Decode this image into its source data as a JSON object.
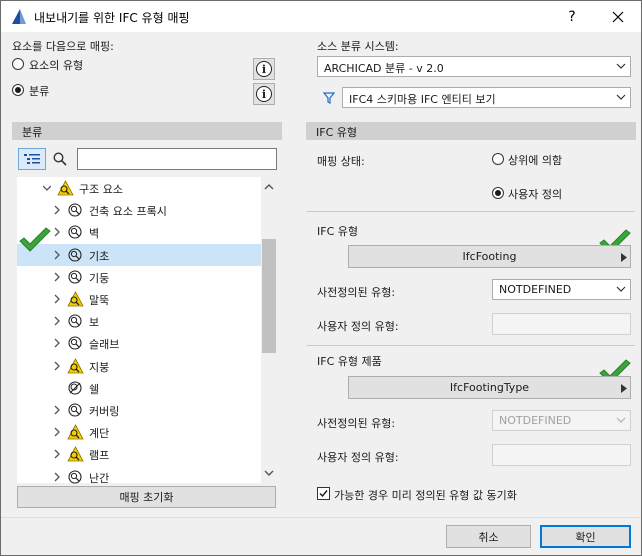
{
  "window": {
    "title": "내보내기를 위한 IFC 유형 매핑",
    "help_label": "?",
    "close_label": "✕"
  },
  "left": {
    "map_elements_label": "요소를 다음으로 매핑:",
    "option_element_type": "요소의 유형",
    "option_classification": "분류",
    "selected_option": "classification",
    "panel_title": "분류",
    "search_value": "",
    "tree": [
      {
        "label": "구조 요소",
        "level": 0,
        "expanded": true,
        "icon": "warning-classification-icon"
      },
      {
        "label": "건축 요소 프록시",
        "level": 1,
        "icon": "classification-icon"
      },
      {
        "label": "벽",
        "level": 1,
        "icon": "classification-icon"
      },
      {
        "label": "기초",
        "level": 1,
        "icon": "classification-icon",
        "selected": true,
        "mapped": true
      },
      {
        "label": "기둥",
        "level": 1,
        "icon": "classification-icon"
      },
      {
        "label": "말뚝",
        "level": 1,
        "icon": "warning-classification-icon"
      },
      {
        "label": "보",
        "level": 1,
        "icon": "classification-icon"
      },
      {
        "label": "슬래브",
        "level": 1,
        "icon": "classification-icon"
      },
      {
        "label": "지붕",
        "level": 1,
        "icon": "warning-classification-icon"
      },
      {
        "label": "쉘",
        "level": 1,
        "icon": "excluded-classification-icon",
        "no_expander": true
      },
      {
        "label": "커버링",
        "level": 1,
        "icon": "classification-icon"
      },
      {
        "label": "계단",
        "level": 1,
        "icon": "warning-classification-icon"
      },
      {
        "label": "램프",
        "level": 1,
        "icon": "warning-classification-icon"
      },
      {
        "label": "난간",
        "level": 1,
        "icon": "classification-icon"
      }
    ],
    "reset_button": "매핑 초기화"
  },
  "right": {
    "source_system_label": "소스 분류 시스템:",
    "source_system_value": "ARCHICAD 분류 - v 2.0",
    "filter_value": "IFC4 스키마용 IFC 엔티티 보기",
    "panel_title": "IFC 유형",
    "mapping_status_label": "매핑 상태:",
    "status_option_parent": "상위에 의함",
    "status_option_custom": "사용자 정의",
    "status_selected": "custom",
    "ifc_type_section": "IFC 유형",
    "ifc_type_value": "IfcFooting",
    "predefined_type_label": "사전정의된 유형:",
    "predefined_type_value": "NOTDEFINED",
    "user_defined_type_label": "사용자 정의 유형:",
    "ifc_product_section": "IFC 유형 제품",
    "ifc_product_value": "IfcFootingType",
    "product_predefined_label": "사전정의된 유형:",
    "product_predefined_value": "NOTDEFINED",
    "product_user_defined_label": "사용자 정의 유형:",
    "sync_checkbox_label": "가능한 경우 미리 정의된 유형 값 동기화",
    "sync_checked": true
  },
  "footer": {
    "cancel_button": "취소",
    "ok_button": "확인"
  },
  "colors": {
    "accent": "#0078d7",
    "check_green": "#3aa53a",
    "warning_yellow": "#f5d000",
    "selected_row": "#cce4f7"
  }
}
